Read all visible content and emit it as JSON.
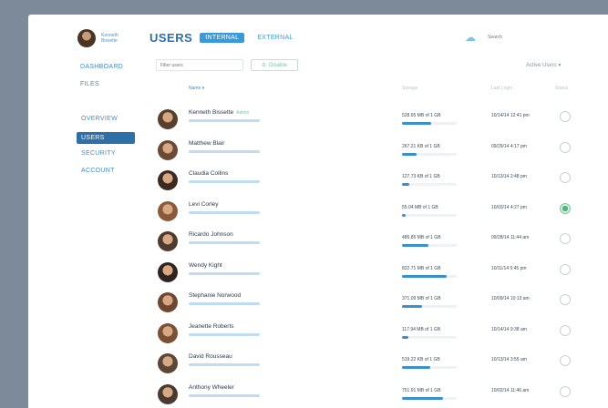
{
  "profile": {
    "name": "Kenneth Bissette"
  },
  "nav": {
    "top": [
      "DASHBOARD",
      "FILES"
    ],
    "sub": [
      "OVERVIEW",
      "USERS",
      "SECURITY",
      "ACCOUNT"
    ]
  },
  "header": {
    "title": "USERS",
    "tabs": [
      "INTERNAL",
      "EXTERNAL"
    ]
  },
  "search": {
    "placeholder": "Search"
  },
  "toolbar": {
    "filter_placeholder": "Filter users",
    "disable_label": "Disable",
    "active_filter": "Active Users"
  },
  "columns": {
    "name": "Name",
    "storage": "Storage",
    "last_login": "Last Login",
    "status": "Status"
  },
  "users": [
    {
      "name": "Kenneth Bissette",
      "tag": "Admin",
      "storage": "528.65 MB of 1 GB",
      "usage": 0.53,
      "last_login": "10/14/14 12:41 pm",
      "active": false
    },
    {
      "name": "Matthew Blair",
      "tag": "",
      "storage": "267.21 KB of 1 GB",
      "usage": 0.27,
      "last_login": "09/29/14 4:17 pm",
      "active": false
    },
    {
      "name": "Claudia Collins",
      "tag": "",
      "storage": "127.73 KB of 1 GB",
      "usage": 0.13,
      "last_login": "10/13/14 2:48 pm",
      "active": false
    },
    {
      "name": "Levi Corley",
      "tag": "",
      "storage": "55.04 MB of 1 GB",
      "usage": 0.06,
      "last_login": "10/03/14 4:27 pm",
      "active": true
    },
    {
      "name": "Ricardo Johnson",
      "tag": "",
      "storage": "485.85 MB of 1 GB",
      "usage": 0.49,
      "last_login": "09/28/14 11:44 am",
      "active": false
    },
    {
      "name": "Wendy Kight",
      "tag": "",
      "storage": "822.71 MB of 1 GB",
      "usage": 0.82,
      "last_login": "10/11/14 5:45 pm",
      "active": false
    },
    {
      "name": "Stephanie Norwood",
      "tag": "",
      "storage": "371.09 MB of 1 GB",
      "usage": 0.37,
      "last_login": "10/09/14 10:13 am",
      "active": false
    },
    {
      "name": "Jeanette Roberts",
      "tag": "",
      "storage": "117.94 MB of 1 GB",
      "usage": 0.12,
      "last_login": "10/14/14 9:38 am",
      "active": false
    },
    {
      "name": "David Rousseau",
      "tag": "",
      "storage": "519.22 KB of 1 GB",
      "usage": 0.52,
      "last_login": "10/13/14 3:55 am",
      "active": false
    },
    {
      "name": "Anthony Wheeler",
      "tag": "",
      "storage": "751.91 MB of 1 GB",
      "usage": 0.75,
      "last_login": "10/02/14 11:46 am",
      "active": false
    }
  ],
  "colors": {
    "accent": "#3a8fd0",
    "active_nav": "#2f6fa8",
    "status_on": "#4cb77b"
  }
}
